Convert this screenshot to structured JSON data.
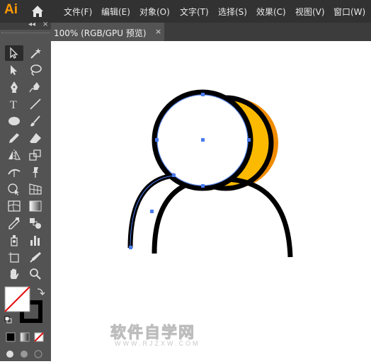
{
  "app": {
    "logo": "Ai",
    "menu": [
      "文件(F)",
      "编辑(E)",
      "对象(O)",
      "文字(T)",
      "选择(S)",
      "效果(C)",
      "视图(V)",
      "窗口(W)"
    ]
  },
  "toolbox": {
    "header_collapse": "◂◂",
    "header_close": "×",
    "text_tool_glyph": "T"
  },
  "document": {
    "tab_title": "100% (RGB/GPU 预览)",
    "tab_close": "×"
  },
  "artwork": {
    "head_fill": "#FBBA00",
    "head_shadow": "#F08C00",
    "stroke": "#000000",
    "path_selection": "#4A7CF0"
  },
  "watermark": {
    "main": "软件自学网",
    "sub": "WWW.RJZXW.COM"
  },
  "colors": {
    "menubar_bg": "#323232",
    "panel_bg": "#535353",
    "logo": "#FF9A00"
  }
}
